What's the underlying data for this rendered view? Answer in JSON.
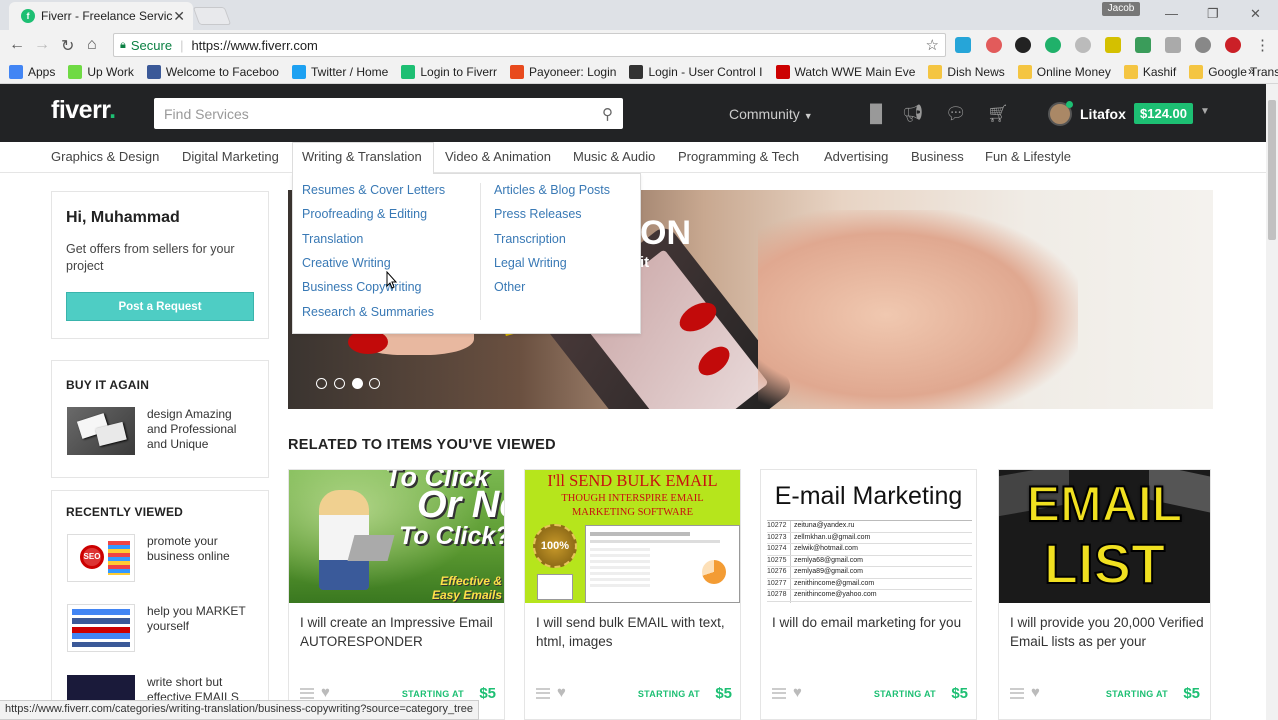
{
  "browser": {
    "tab_title": "Fiverr - Freelance Service",
    "tab_favicon": "f",
    "profile_name": "Jacob",
    "url_secure": "Secure",
    "url": "https://www.fiverr.com",
    "bookmarks": [
      {
        "label": "Apps",
        "icon": "apps-grid-icon",
        "color": "#4285f4"
      },
      {
        "label": "Up Work",
        "icon": "upwork-icon",
        "color": "#6fda44"
      },
      {
        "label": "Welcome to Faceboo",
        "icon": "facebook-icon",
        "color": "#3b5998"
      },
      {
        "label": "Twitter / Home",
        "icon": "twitter-icon",
        "color": "#1da1f2"
      },
      {
        "label": "Login to Fiverr",
        "icon": "fiverr-icon",
        "color": "#1dbf73"
      },
      {
        "label": "Payoneer: Login",
        "icon": "payoneer-icon",
        "color": "#e84a1d"
      },
      {
        "label": "Login - User Control I",
        "icon": "spy-icon",
        "color": "#333333"
      },
      {
        "label": "Watch WWE Main Eve",
        "icon": "wwe-icon",
        "color": "#cc0000"
      },
      {
        "label": "Dish News",
        "icon": "folder-icon",
        "color": "#f4c542"
      },
      {
        "label": "Online Money",
        "icon": "folder-icon",
        "color": "#f4c542"
      },
      {
        "label": "Kashif",
        "icon": "folder-icon",
        "color": "#f4c542"
      },
      {
        "label": "Google Translate",
        "icon": "folder-icon",
        "color": "#f4c542"
      }
    ],
    "more_bookmarks": "»",
    "status_url": "https://www.fiverr.com/categories/writing-translation/business-copywriting?source=category_tree"
  },
  "header": {
    "logo": "fiverr",
    "logo_dot": ".",
    "search_placeholder": "Find Services",
    "community": "Community",
    "username": "Litafox",
    "balance": "$124.00"
  },
  "categories": [
    "Graphics & Design",
    "Digital Marketing",
    "Writing & Translation",
    "Video & Animation",
    "Music & Audio",
    "Programming & Tech",
    "Advertising",
    "Business",
    "Fun & Lifestyle"
  ],
  "dropdown": {
    "left": [
      "Resumes & Cover Letters",
      "Proofreading & Editing",
      "Translation",
      "Creative Writing",
      "Business Copywriting",
      "Research & Summaries"
    ],
    "right": [
      "Articles & Blog Posts",
      "Press Releases",
      "Transcription",
      "Legal Writing",
      "Other"
    ]
  },
  "sidebar": {
    "greeting": "Hi, Muhammad",
    "greeting_desc": "Get offers from sellers for your project",
    "post_button": "Post a Request",
    "buy_again_title": "BUY IT AGAIN",
    "buy_again_item": "design Amazing and Professional and Unique",
    "recently_viewed_title": "RECENTLY VIEWED",
    "recent_items": [
      "promote your business online",
      "help you MARKET yourself",
      "write short but effective EMAILS"
    ]
  },
  "hero": {
    "text_fragment": "ON",
    "text_fragment2": "it",
    "active_slide": 3,
    "slide_count": 4
  },
  "related": {
    "title": "RELATED TO ITEMS YOU'VE VIEWED",
    "starting_label": "STARTING AT",
    "cards": [
      {
        "title": "I will create an Impressive Email AUTORESPONDER",
        "price": "$5",
        "img_text1": "To Click",
        "img_text2": "Or Not",
        "img_text3": "To Click?",
        "img_text4": "Effective & Easy Emails"
      },
      {
        "title": "I will send bulk EMAIL with text, html, images",
        "price": "$5",
        "img_text1": "I'll SEND BULK EMAIL",
        "img_text2": "THOUGH INTERSPIRE EMAIL MARKETING SOFTWARE",
        "img_text3": "100%"
      },
      {
        "title": "I will do email marketing for you",
        "price": "$5",
        "img_text1": "E-mail Marketing",
        "emails": [
          "zeituna@yandex.ru",
          "zellmkhan.u@gmail.com",
          "zelwik@hotmail.com",
          "zemlya68@gmail.com",
          "zemlya89@gmail.com",
          "zenithincome@gmail.com",
          "zenithincome@yahoo.com",
          "zeph_horus@yahoo.com"
        ],
        "ids": [
          "10272",
          "10273",
          "10274",
          "10275",
          "10276",
          "10277",
          "10278",
          "10279"
        ]
      },
      {
        "title": "I will provide you 20,000 Verified EmaiL lists as per your",
        "price": "$5",
        "img_text1": "EMAIL",
        "img_text2": "LIST"
      }
    ]
  }
}
